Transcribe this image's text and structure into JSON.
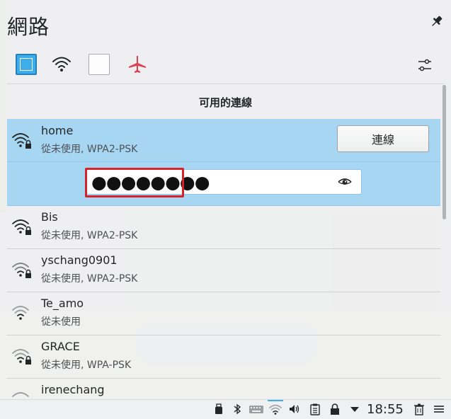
{
  "applet": {
    "title": "網路",
    "pin_icon": "pin-icon",
    "settings_icon": "configure-icon"
  },
  "toggles": {
    "ethernet_checked": true,
    "wireless_checked": false,
    "wifi_icon": "wifi-icon",
    "airplane_icon": "airplane-icon",
    "accent": "#3daee9",
    "airplane_color": "#da4453"
  },
  "list": {
    "section_title": "可用的連線",
    "highlight_color": "#a7d6f2",
    "networks": [
      {
        "name": "home",
        "status": "從未使用, WPA2-PSK",
        "secured": true,
        "expanded": true
      },
      {
        "name": "Bis",
        "status": "從未使用, WPA2-PSK",
        "secured": true
      },
      {
        "name": "yschang0901",
        "status": "從未使用, WPA2-PSK",
        "secured": true
      },
      {
        "name": "Te_amo",
        "status": "從未使用",
        "secured": false
      },
      {
        "name": "GRACE",
        "status": "從未使用, WPA-PSK",
        "secured": true
      },
      {
        "name": "irenechang",
        "status": "",
        "secured": false
      }
    ],
    "connect_label": "連線",
    "password_value": "●●●●●●●●",
    "show_password_icon": "eye-icon",
    "annotation_color": "#d8222a"
  },
  "panel": {
    "clock": "18:55",
    "tray_icons": [
      "usb-icon",
      "bluetooth-icon",
      "keyboard-icon",
      "network-wifi-icon",
      "volume-icon",
      "clipboard-icon",
      "lock-icon",
      "expand-arrow-icon",
      "trash-icon",
      "menu-icon"
    ]
  }
}
